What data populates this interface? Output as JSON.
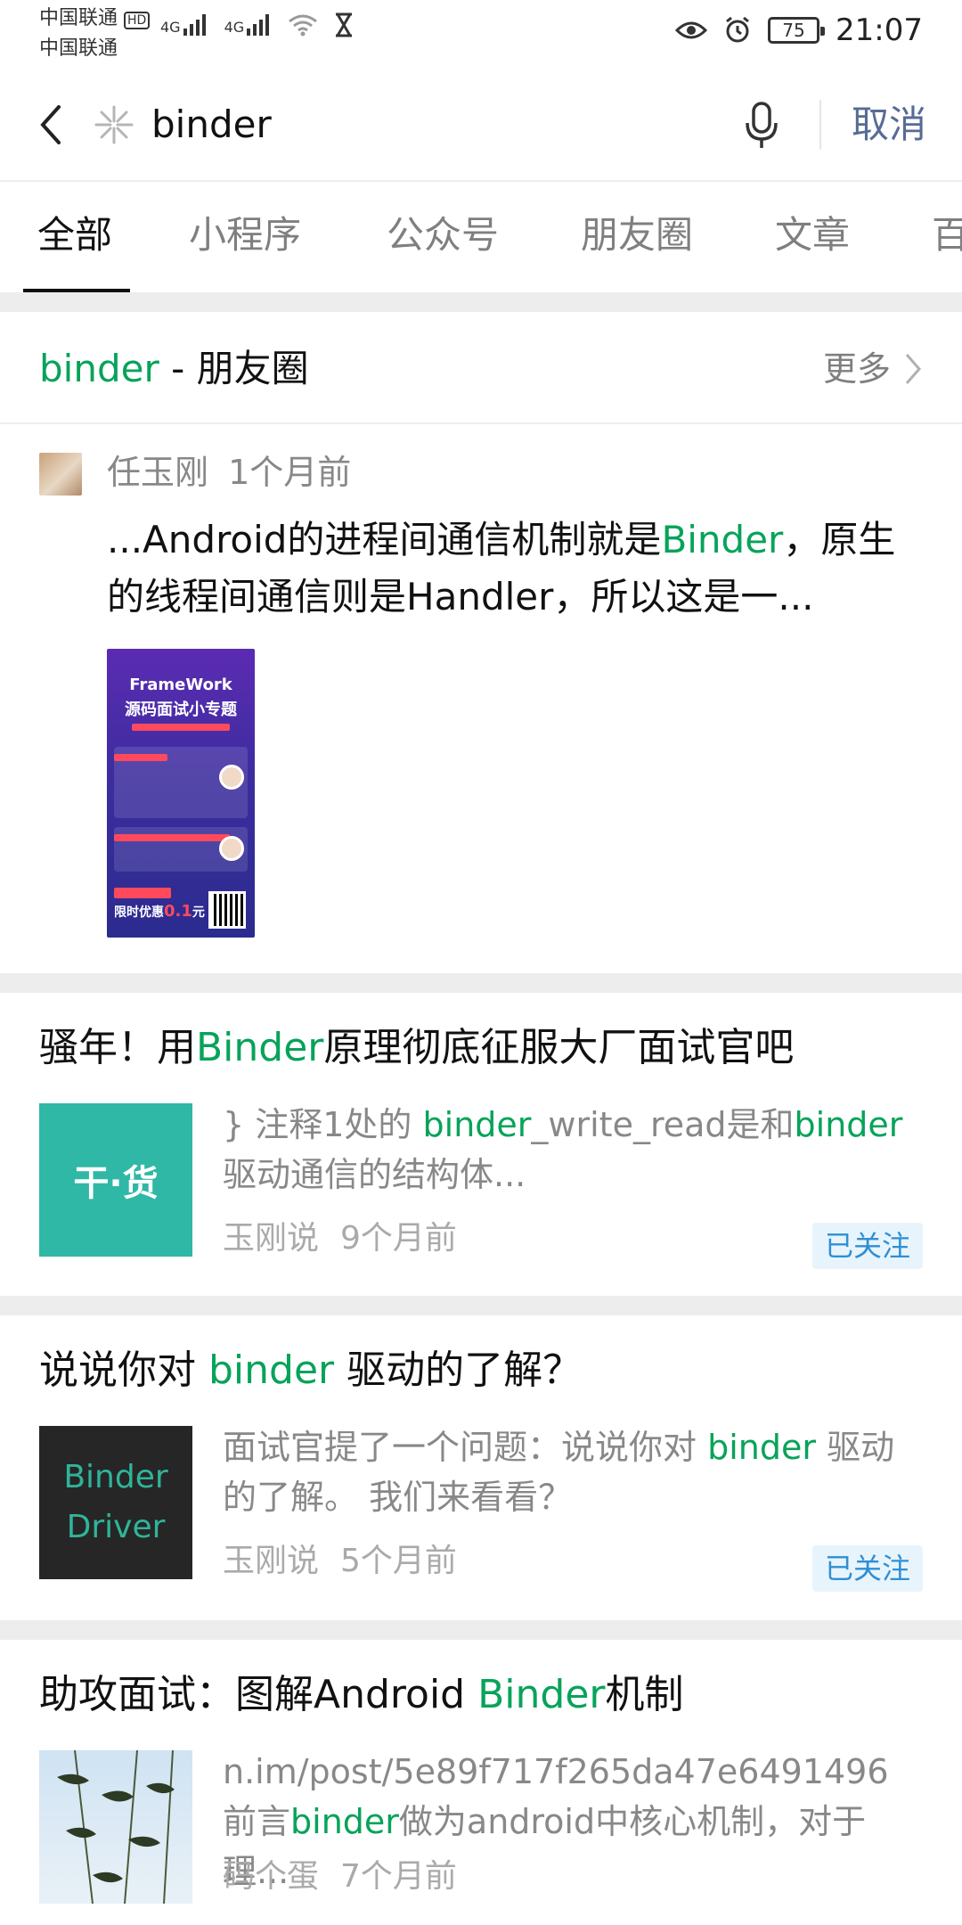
{
  "status_bar": {
    "carrier_1": "中国联通",
    "hd": "HD",
    "carrier_2": "中国联通",
    "net_1": "4G",
    "net_2": "4G",
    "battery": "75",
    "time": "21:07"
  },
  "search": {
    "query": "binder",
    "cancel_label": "取消"
  },
  "tabs": [
    {
      "label": "全部",
      "active": true
    },
    {
      "label": "小程序"
    },
    {
      "label": "公众号"
    },
    {
      "label": "朋友圈"
    },
    {
      "label": "文章"
    },
    {
      "label": "百"
    }
  ],
  "moments_section": {
    "keyword": "binder",
    "suffix": " - 朋友圈",
    "more_label": "更多",
    "post": {
      "author": "任玉刚",
      "time": "1个月前",
      "text_1": "...Android的进程间通信机制就是",
      "text_kw": "Binder",
      "text_2": "，原生的线程间通信则是Handler，所以这是一...",
      "poster": {
        "tag": "FrameWork",
        "headline": "源码面试小专题",
        "price_label": "限时优惠",
        "price_value": "0.1",
        "price_unit": "元"
      }
    }
  },
  "articles": [
    {
      "title_pre": "骚年！用",
      "title_kw": "Binder",
      "title_post": "原理彻底征服大厂面试官吧",
      "thumb_text": "干·货",
      "snippet_1": "} 注释1处的 ",
      "snippet_kw1": "binder",
      "snippet_2": "_write_read是和",
      "snippet_kw2": "binder",
      "snippet_3": "驱动通信的结构体...",
      "source": "玉刚说",
      "time": "9个月前",
      "badge": "已关注"
    },
    {
      "title_pre": "说说你对 ",
      "title_kw": "binder",
      "title_post": " 驱动的了解？",
      "thumb_line1": "Binder",
      "thumb_line2": "Driver",
      "snippet_1": "面试官提了一个问题：说说你对 ",
      "snippet_kw1": "binder",
      "snippet_2": " 驱动的了解。 我们来看看？",
      "source": "玉刚说",
      "time": "5个月前",
      "badge": "已关注"
    },
    {
      "title_pre": "助攻面试：图解Android ",
      "title_kw": "Binder",
      "title_post": "机制",
      "snippet_1": "n.im/post/5e89f717f265da47e6491496 前言",
      "snippet_kw1": "binder",
      "snippet_2": "做为android中核心机制，对于理...",
      "source": "码个蛋",
      "time": "7个月前"
    }
  ],
  "colors": {
    "keyword": "#07a35a",
    "link_blue": "#576b95",
    "follow_badge": "#2e8fd6"
  }
}
